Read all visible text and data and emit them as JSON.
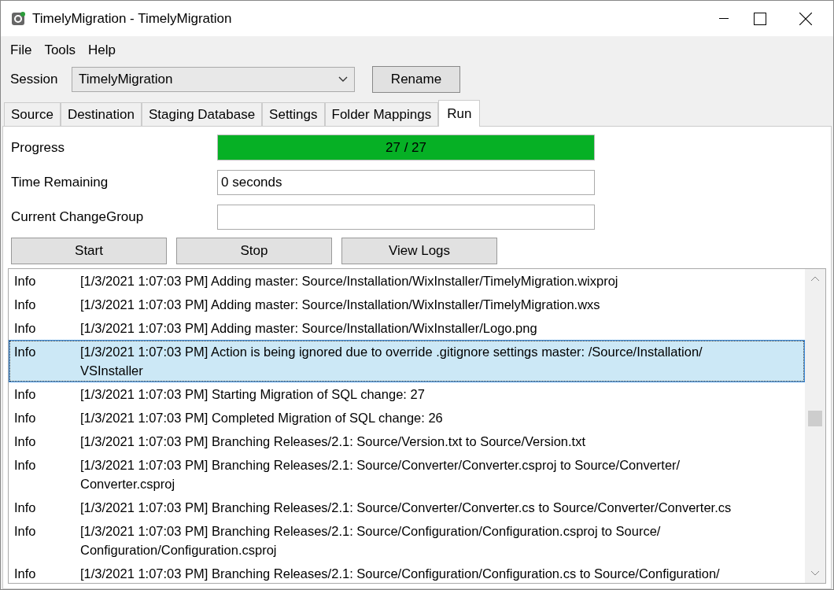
{
  "window": {
    "title": "TimelyMigration - TimelyMigration"
  },
  "menu": [
    "File",
    "Tools",
    "Help"
  ],
  "session": {
    "label": "Session",
    "value": "TimelyMigration",
    "button": "Rename"
  },
  "tabs": [
    {
      "label": "Source",
      "selected": false
    },
    {
      "label": "Destination",
      "selected": false
    },
    {
      "label": "Staging Database",
      "selected": false
    },
    {
      "label": "Settings",
      "selected": false
    },
    {
      "label": "Folder Mappings",
      "selected": false
    },
    {
      "label": "Run",
      "selected": true
    }
  ],
  "progress": {
    "label": "Progress",
    "level": 1,
    "reading": "27 / 27"
  },
  "time_remaining": {
    "label": "Time Remaining",
    "value": "0 seconds"
  },
  "current_change_group": {
    "label": "Current ChangeGroup"
  },
  "buttons": [
    "Start",
    "Stop",
    "View Logs"
  ],
  "log": [
    {
      "level": "Info",
      "message": "[1/3/2021 1:07:03 PM] Adding master: Source/Installation/WixInstaller/TimelyMigration.wixproj",
      "selected": false
    },
    {
      "level": "Info",
      "message": "[1/3/2021 1:07:03 PM] Adding master: Source/Installation/WixInstaller/TimelyMigration.wxs",
      "selected": false
    },
    {
      "level": "Info",
      "message": "[1/3/2021 1:07:03 PM] Adding master: Source/Installation/WixInstaller/Logo.png",
      "selected": false
    },
    {
      "level": "Info",
      "message": "[1/3/2021 1:07:03 PM] Action is being ignored due to override .gitignore settings master: /Source/Installation/ VSInstaller",
      "selected": true
    },
    {
      "level": "Info",
      "message": "[1/3/2021 1:07:03 PM] Starting Migration of SQL change: 27",
      "selected": false
    },
    {
      "level": "Info",
      "message": "[1/3/2021 1:07:03 PM] Completed Migration of SQL change: 26",
      "selected": false
    },
    {
      "level": "Info",
      "message": "[1/3/2021 1:07:03 PM] Branching Releases/2.1: Source/Version.txt to Source/Version.txt",
      "selected": false
    },
    {
      "level": "Info",
      "message": "[1/3/2021 1:07:03 PM] Branching Releases/2.1: Source/Converter/Converter.csproj to Source/Converter/ Converter.csproj",
      "selected": false
    },
    {
      "level": "Info",
      "message": "[1/3/2021 1:07:03 PM] Branching Releases/2.1: Source/Converter/Converter.cs to Source/Converter/Converter.cs",
      "selected": false
    },
    {
      "level": "Info",
      "message": "[1/3/2021 1:07:03 PM] Branching Releases/2.1: Source/Configuration/Configuration.csproj to Source/ Configuration/Configuration.csproj",
      "selected": false
    },
    {
      "level": "Info",
      "message": "[1/3/2021 1:07:03 PM] Branching Releases/2.1: Source/Configuration/Configuration.cs to Source/Configuration/",
      "selected": false
    }
  ]
}
